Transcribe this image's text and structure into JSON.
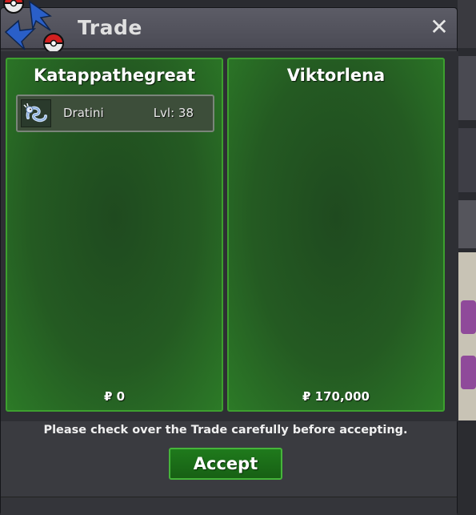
{
  "window": {
    "title": "Trade",
    "close_symbol": "✕",
    "logo_icon": "pokeball-swap-icon"
  },
  "trade": {
    "left": {
      "name": "Katappathegreat",
      "items": [
        {
          "name": "Dratini",
          "level": "Lvl: 38",
          "icon": "dratini-sprite-icon"
        }
      ],
      "money": "₽ 0"
    },
    "right": {
      "name": "Viktorlena",
      "items": [],
      "money": "₽ 170,000"
    }
  },
  "footer": {
    "notice": "Please check over the Trade carefully before accepting.",
    "accept_label": "Accept"
  },
  "colors": {
    "panel_border": "#3da02f",
    "accept_bg": "#1f7a1c",
    "title_bar": "#5c5c66"
  }
}
